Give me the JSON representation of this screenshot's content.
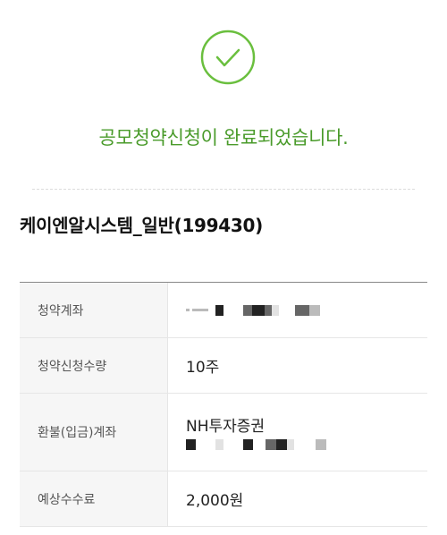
{
  "status": {
    "icon": "check-circle-icon",
    "color": "#6abf3e",
    "message": "공모청약신청이 완료되었습니다."
  },
  "stock": {
    "title": "케이엔알시스템_일반(199430)"
  },
  "details": {
    "account_label": "청약계좌",
    "account_value": "masked",
    "quantity_label": "청약신청수량",
    "quantity_value": "10주",
    "refund_label": "환불(입금)계좌",
    "refund_bank": "NH투자증권",
    "refund_account": "masked",
    "fee_label": "예상수수료",
    "fee_value": "2,000원"
  }
}
